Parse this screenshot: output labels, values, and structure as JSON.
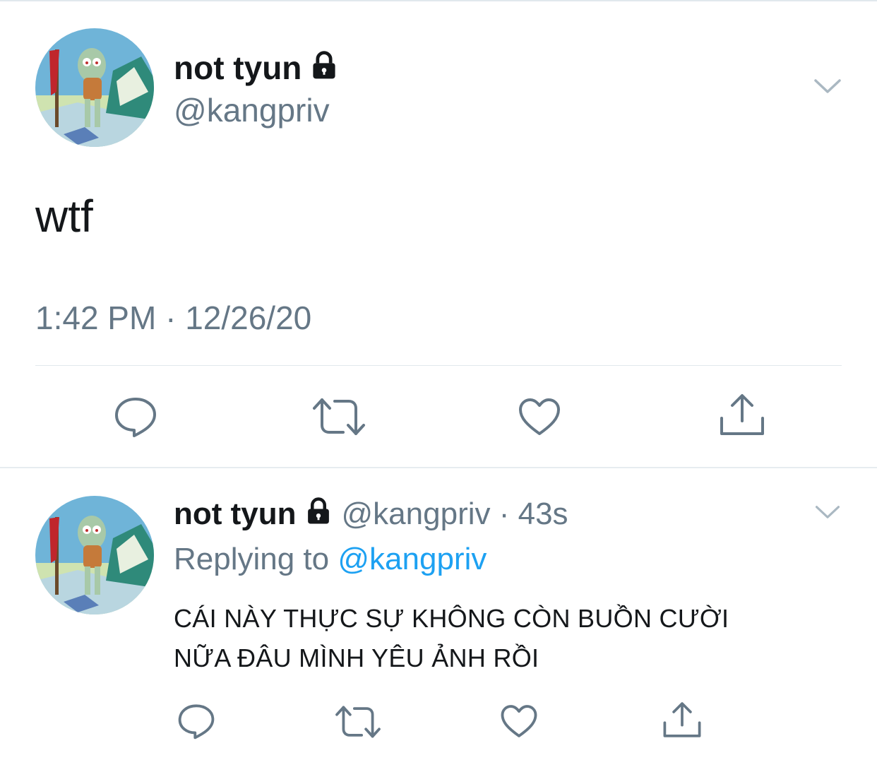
{
  "main_tweet": {
    "display_name": "not tyun",
    "handle": "@kangpriv",
    "text": "wtf",
    "timestamp": "1:42 PM · 12/26/20",
    "icons": {
      "lock": "lock-icon",
      "caret": "chevron-down-icon",
      "reply": "reply-icon",
      "retweet": "retweet-icon",
      "like": "heart-icon",
      "share": "share-icon"
    }
  },
  "reply_tweet": {
    "display_name": "not tyun",
    "handle_time": "@kangpriv · 43s",
    "replying_prefix": "Replying to",
    "replying_to": "@kangpriv",
    "text_line1": "CÁI NÀY THỰC SỰ KHÔNG CÒN BUỒN CƯỜI",
    "text_line2": "NỮA ĐÂU MÌNH YÊU ẢNH RỒI"
  },
  "colors": {
    "text_primary": "#14171a",
    "text_secondary": "#657786",
    "link": "#1da1f2",
    "icon": "#657786",
    "divider": "#e1e8ed"
  }
}
